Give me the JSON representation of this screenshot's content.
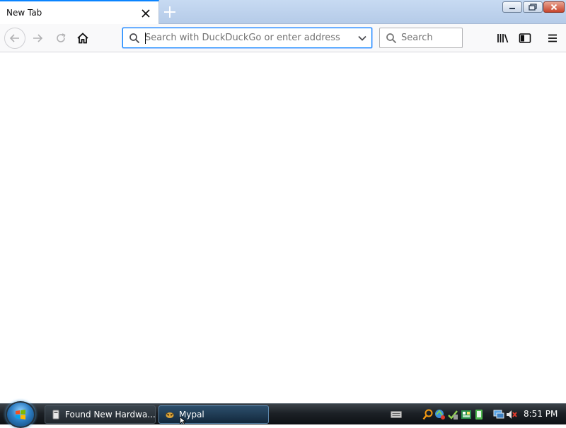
{
  "tab": {
    "title": "New Tab"
  },
  "window_controls": [
    "minimize",
    "maximize",
    "close"
  ],
  "toolbar": {
    "buttons": [
      "back",
      "forward",
      "reload",
      "home"
    ],
    "right_buttons": [
      "library",
      "sidebar",
      "menu"
    ]
  },
  "urlbar": {
    "value": "",
    "placeholder": "Search with DuckDuckGo or enter address",
    "focused": true
  },
  "searchbar": {
    "value": "",
    "placeholder": "Search"
  },
  "taskbar": {
    "tasks": [
      {
        "label": "Found New Hardwa...",
        "active": false
      },
      {
        "label": "Mypal",
        "active": true
      }
    ],
    "clock": "8:51 PM",
    "tray_icons": [
      "keyboard-icon",
      "search-icon",
      "network-icon",
      "security-icon",
      "app-icon",
      "app-icon",
      "monitor-icon",
      "volume-muted-icon"
    ]
  },
  "colors": {
    "accent": "#0a84ff",
    "taskbar": "#1c2126",
    "tab_strip": "#c7daf2"
  }
}
